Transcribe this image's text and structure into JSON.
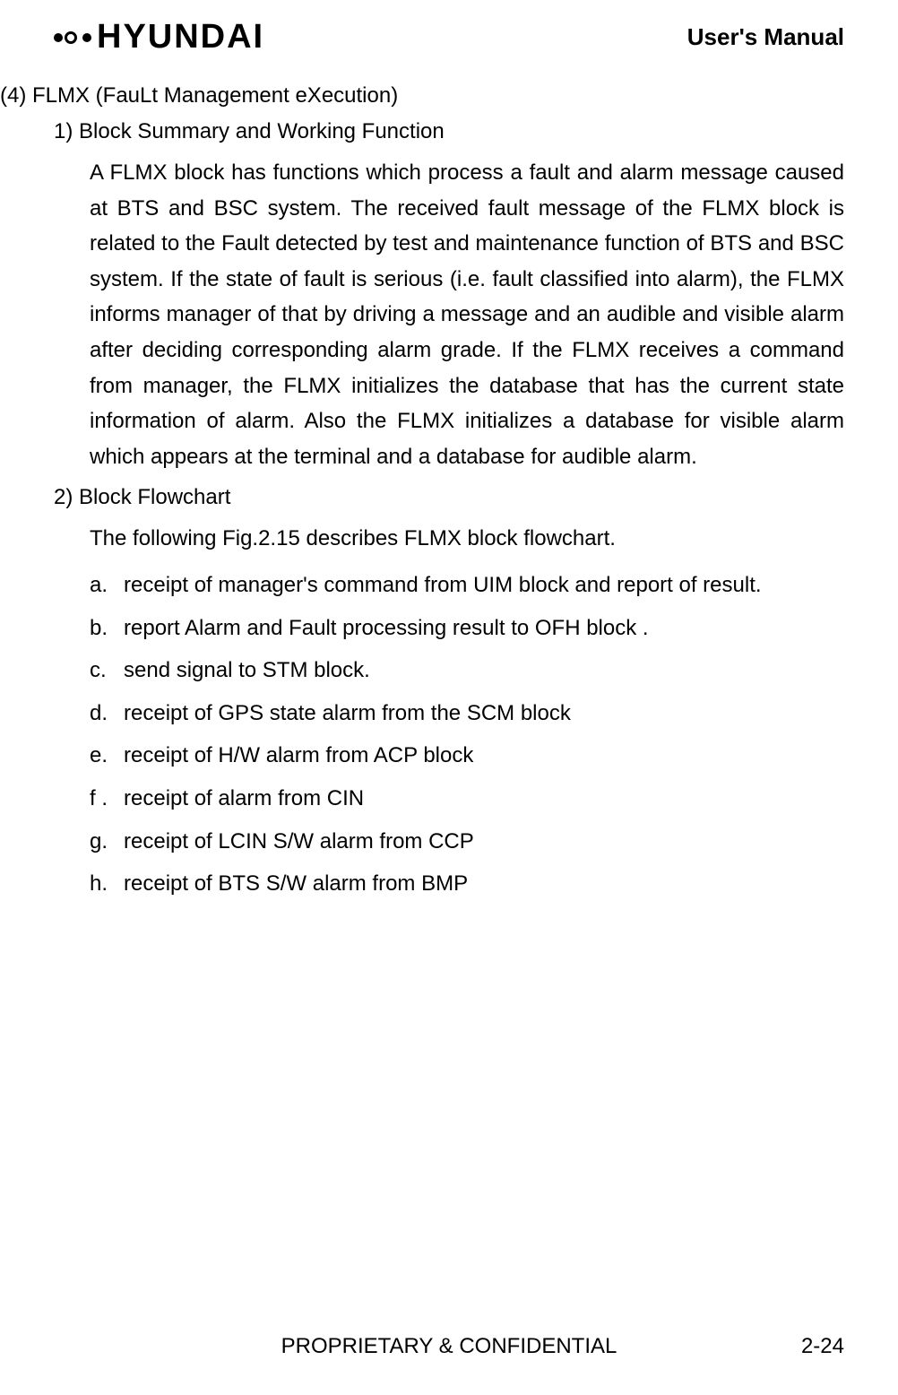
{
  "header": {
    "logo_text": "HYUNDAI",
    "doc_title": "User's Manual"
  },
  "content": {
    "section_title": "(4) FLMX (FauLt Management eXecution)",
    "sub1_title": "1) Block Summary and Working Function",
    "sub1_body": "A FLMX block has functions which process a fault and alarm message caused at BTS and BSC system. The received fault message of the FLMX block is related to the Fault detected by test and maintenance function of BTS and BSC system. If the state of fault is serious (i.e. fault classified into alarm), the FLMX informs manager of that by driving a message and an audible and visible alarm after deciding corresponding alarm grade. If the FLMX receives a command from manager, the FLMX  initializes the database that has the current state information of alarm. Also the FLMX initializes a database for visible alarm which appears at the terminal and a database for audible alarm.",
    "sub2_title": "2) Block Flowchart",
    "sub2_intro": "The following Fig.2.15 describes FLMX block flowchart.",
    "items": [
      {
        "marker": "a.",
        "text": "receipt of manager's command from UIM block and report of result."
      },
      {
        "marker": "b.",
        "text": "report Alarm and Fault processing result to OFH block ."
      },
      {
        "marker": "c.",
        "text": "send signal to STM block."
      },
      {
        "marker": "d.",
        "text": "receipt of GPS state alarm from the SCM block"
      },
      {
        "marker": "e.",
        "text": "receipt of H/W alarm from ACP block"
      },
      {
        "marker": "f .",
        "text": "receipt of alarm from CIN"
      },
      {
        "marker": "g.",
        "text": "receipt of LCIN S/W alarm from CCP"
      },
      {
        "marker": "h.",
        "text": "receipt of BTS S/W alarm from BMP"
      }
    ]
  },
  "footer": {
    "text": "PROPRIETARY & CONFIDENTIAL",
    "page": "2-24"
  }
}
